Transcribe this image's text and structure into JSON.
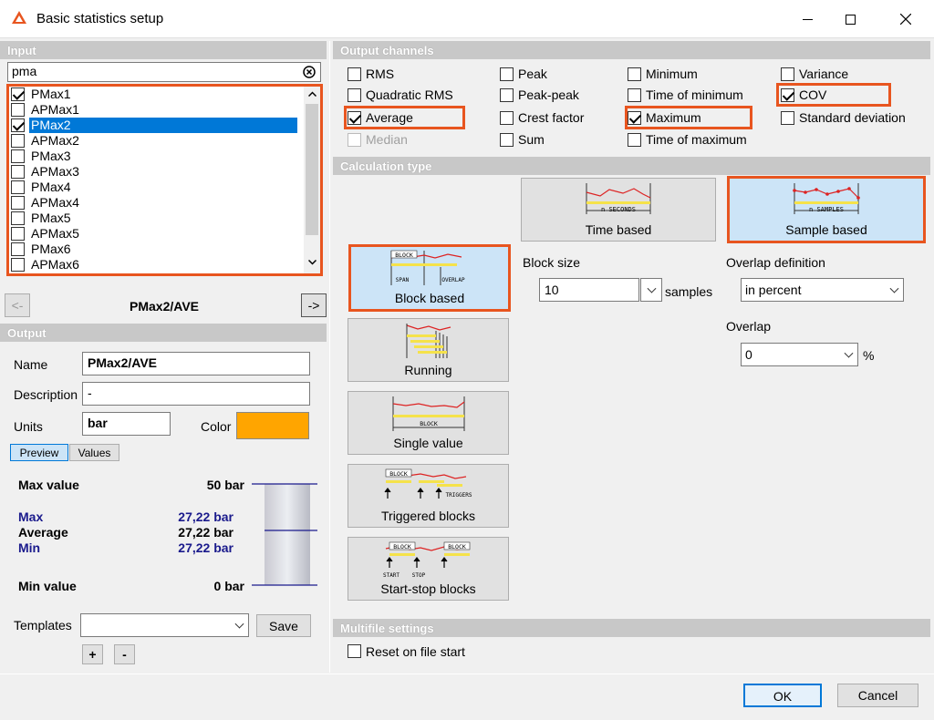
{
  "window": {
    "title": "Basic statistics setup"
  },
  "input": {
    "header": "Input",
    "search_value": "pma",
    "items": [
      {
        "label": "PMax1",
        "checked": true
      },
      {
        "label": "APMax1",
        "checked": false
      },
      {
        "label": "PMax2",
        "checked": true,
        "selected": true
      },
      {
        "label": "APMax2",
        "checked": false
      },
      {
        "label": "PMax3",
        "checked": false
      },
      {
        "label": "APMax3",
        "checked": false
      },
      {
        "label": "PMax4",
        "checked": false
      },
      {
        "label": "APMax4",
        "checked": false
      },
      {
        "label": "PMax5",
        "checked": false
      },
      {
        "label": "APMax5",
        "checked": false
      },
      {
        "label": "PMax6",
        "checked": false
      },
      {
        "label": "APMax6",
        "checked": false
      }
    ],
    "prev_label": "<-",
    "next_label": "->",
    "current_channel": "PMax2/AVE"
  },
  "output": {
    "header": "Output",
    "name_label": "Name",
    "name_value": "PMax2/AVE",
    "description_label": "Description",
    "description_value": "-",
    "units_label": "Units",
    "units_value": "bar",
    "color_label": "Color",
    "color_value": "#ffa500",
    "tab_preview": "Preview",
    "tab_values": "Values",
    "max_value_label": "Max value",
    "max_value": "50 bar",
    "max_label": "Max",
    "max": "27,22 bar",
    "average_label": "Average",
    "average": "27,22 bar",
    "min_label": "Min",
    "min": "27,22 bar",
    "min_value_label": "Min value",
    "min_value": "0 bar",
    "templates_label": "Templates",
    "templates_value": "",
    "save_label": "Save",
    "add_label": "+",
    "remove_label": "-"
  },
  "output_channels": {
    "header": "Output channels",
    "options": [
      {
        "label": "RMS",
        "checked": false
      },
      {
        "label": "Quadratic RMS",
        "checked": false
      },
      {
        "label": "Average",
        "checked": true
      },
      {
        "label": "Median",
        "checked": false,
        "disabled": true
      },
      {
        "label": "Peak",
        "checked": false
      },
      {
        "label": "Peak-peak",
        "checked": false
      },
      {
        "label": "Crest factor",
        "checked": false
      },
      {
        "label": "Sum",
        "checked": false
      },
      {
        "label": "Minimum",
        "checked": false
      },
      {
        "label": "Time of minimum",
        "checked": false
      },
      {
        "label": "Maximum",
        "checked": true
      },
      {
        "label": "Time of maximum",
        "checked": false
      },
      {
        "label": "Variance",
        "checked": false
      },
      {
        "label": "COV",
        "checked": true
      },
      {
        "label": "Standard deviation",
        "checked": false
      }
    ]
  },
  "calculation_type": {
    "header": "Calculation type",
    "time_based": "Time based",
    "time_based_icon_text": "n SECONDS",
    "sample_based": "Sample based",
    "sample_based_icon_text": "n SAMPLES",
    "block_based": "Block based",
    "block_icon_block": "BLOCK",
    "block_icon_span": "SPAN",
    "block_icon_overlap": "OVERLAP",
    "running": "Running",
    "single_value": "Single value",
    "single_icon_block": "BLOCK",
    "triggered_blocks": "Triggered blocks",
    "triggered_icon_block": "BLOCK",
    "triggered_icon_triggers": "TRIGGERS",
    "start_stop_blocks": "Start-stop blocks",
    "startstop_icon_block": "BLOCK",
    "startstop_icon_start": "START",
    "startstop_icon_stop": "STOP",
    "block_size_label": "Block size",
    "block_size_value": "10",
    "block_size_unit": "samples",
    "overlap_definition_label": "Overlap definition",
    "overlap_definition_value": "in percent",
    "overlap_label": "Overlap",
    "overlap_value": "0",
    "overlap_unit": "%"
  },
  "multifile": {
    "header": "Multifile settings",
    "reset_label": "Reset on file start",
    "reset_checked": false
  },
  "footer": {
    "ok_label": "OK",
    "cancel_label": "Cancel"
  },
  "colors": {
    "highlight": "#e8551f",
    "selection": "#0078d7",
    "tile_selected": "#cce4f7"
  }
}
